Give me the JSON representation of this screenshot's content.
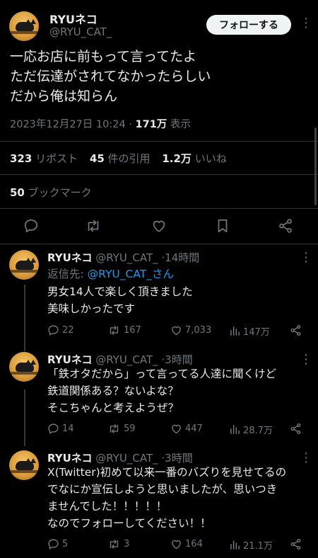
{
  "main_tweet": {
    "display_name": "RYUネコ",
    "handle": "@RYU_CAT_",
    "follow_label": "フォローする",
    "more_label": "⋮",
    "text_lines": [
      "一応お店に前もって言ってたよ",
      "ただ伝達がされてなかったらしい",
      "だから俺は知らん"
    ],
    "timestamp": "2023年12月27日 10:24",
    "separator": "·",
    "views_count": "171万",
    "views_label": "表示",
    "reposts_count": "323",
    "reposts_label": "リポスト",
    "quotes_count": "45",
    "quotes_label": "件の引用",
    "likes_count": "1.2万",
    "likes_label": "いいね",
    "bookmarks_count": "50",
    "bookmarks_label": "ブックマーク",
    "action_icons": [
      "reply-icon",
      "repost-icon",
      "like-icon",
      "bookmark-icon",
      "share-icon"
    ]
  },
  "replies": [
    {
      "display_name": "RYUネコ",
      "handle": "@RYU_CAT_",
      "dot": "·",
      "time": "14時間",
      "replying_prefix": "返信先:",
      "replying_to": "@RYU_CAT_さん",
      "lines": [
        "男女14人で楽しく頂きました",
        "美味しかったです"
      ],
      "replies": "22",
      "reposts": "167",
      "likes": "7,033",
      "views": "147万"
    },
    {
      "display_name": "RYUネコ",
      "handle": "@RYU_CAT_",
      "dot": "·",
      "time": "3時間",
      "lines": [
        "「鉄オタだから」って言ってる人達に聞くけど",
        "鉄道関係ある？ないよな？",
        "そこちゃんと考えようぜ？"
      ],
      "replies": "14",
      "reposts": "59",
      "likes": "447",
      "views": "28.7万"
    },
    {
      "display_name": "RYUネコ",
      "handle": "@RYU_CAT_",
      "dot": "·",
      "time": "3時間",
      "lines": [
        "X(Twitter)初めて以来一番のバズりを見せてるの",
        "でなにか宣伝しようと思いましたが、思いつき",
        "ませんでした！！！！！",
        "なのでフォローしてください！！"
      ],
      "replies": "5",
      "reposts": "3",
      "likes": "164",
      "views": "21.1万"
    }
  ],
  "colors": {
    "background": "#000000",
    "text": "#e7e9ea",
    "muted": "#71767b",
    "link": "#1d9bf0",
    "divider": "#2f3336"
  }
}
